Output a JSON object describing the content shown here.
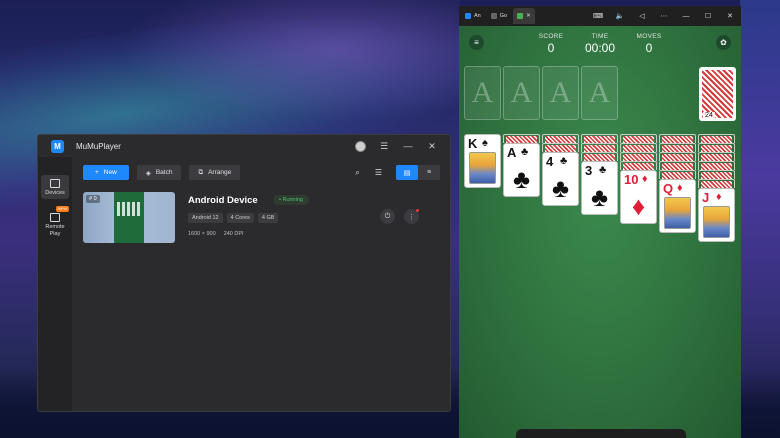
{
  "mumu": {
    "title": "MuMuPlayer",
    "logo_text": "M",
    "sidebar": {
      "devices_label": "Devices",
      "remote_label_1": "Remote",
      "remote_label_2": "Play",
      "new_badge": "NEW"
    },
    "toolbar": {
      "new_label": "New",
      "batch_label": "Batch",
      "arrange_label": "Arrange"
    },
    "device": {
      "index": "# 0",
      "name": "Android Device",
      "status": "Running",
      "specs": [
        "Android 12",
        "4 Cores",
        "4 GB"
      ],
      "resolution": "1600 × 900",
      "dpi": "240 DPI"
    },
    "colors": {
      "accent": "#1e88ff",
      "running": "#49c46a"
    }
  },
  "solitaire_window": {
    "tabs": [
      "An",
      "Go",
      ""
    ],
    "game": {
      "score_label": "SCORE",
      "score_value": "0",
      "time_label": "TIME",
      "time_value": "00:00",
      "moves_label": "MOVES",
      "moves_value": "0",
      "foundation_label": "A",
      "stock_count": "24",
      "tableau": [
        {
          "rank": "K",
          "suit": "♠",
          "red": false,
          "face": true,
          "hidden": 0
        },
        {
          "rank": "A",
          "suit": "♣",
          "red": false,
          "face": false,
          "hidden": 1
        },
        {
          "rank": "4",
          "suit": "♣",
          "red": false,
          "face": false,
          "hidden": 2
        },
        {
          "rank": "3",
          "suit": "♣",
          "red": false,
          "face": false,
          "hidden": 3
        },
        {
          "rank": "10",
          "suit": "♦",
          "red": true,
          "face": false,
          "hidden": 4
        },
        {
          "rank": "Q",
          "suit": "♦",
          "red": true,
          "face": true,
          "hidden": 5
        },
        {
          "rank": "J",
          "suit": "♦",
          "red": true,
          "face": true,
          "hidden": 6
        }
      ]
    }
  }
}
